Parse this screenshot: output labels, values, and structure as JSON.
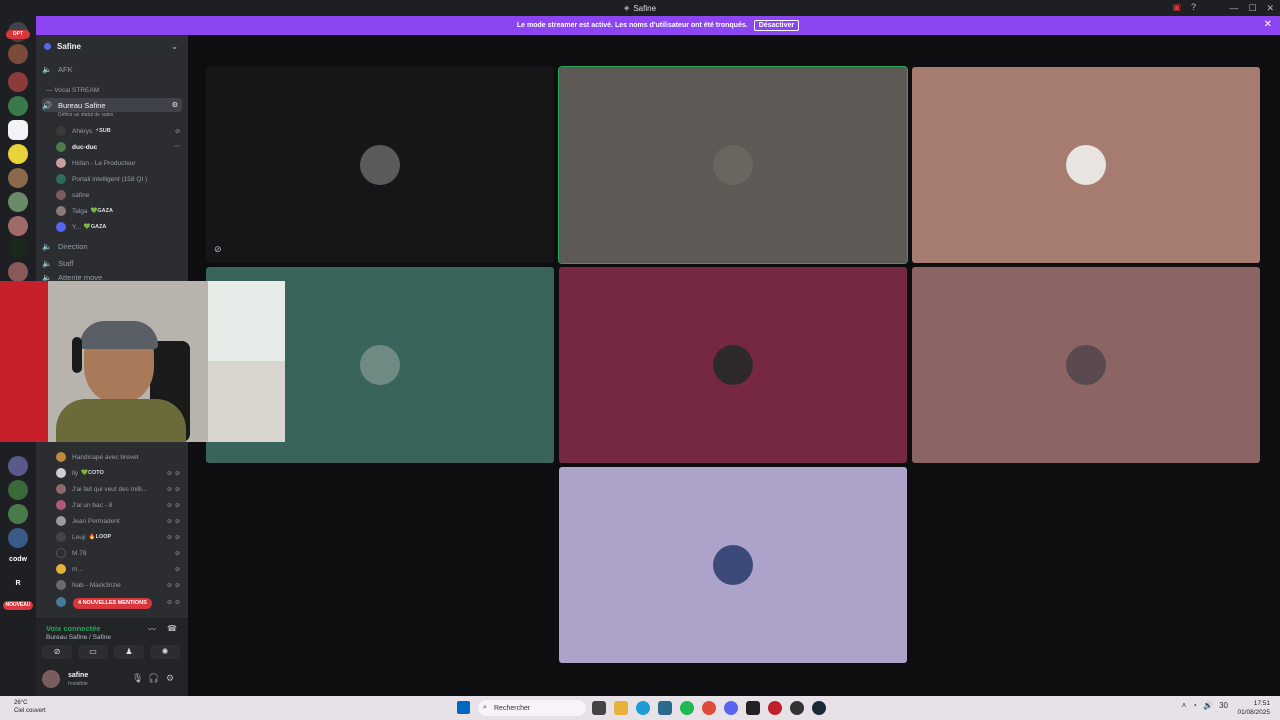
{
  "window": {
    "title": "Safine"
  },
  "banner": {
    "text": "Le mode streamer est activé. Les noms d'utilisateur ont été tronqués.",
    "button": "Désactiver"
  },
  "servers": {
    "top_badge": "DPT",
    "labels": [
      "codw",
      "R"
    ],
    "new_badge": "NOUVEAU"
  },
  "guild": {
    "name": "Safine"
  },
  "channels": {
    "afk": "AFK",
    "category": "— Vocal STREAM",
    "active": "Bureau Safine",
    "active_status": "Définir un statut de salon",
    "direction": "Direction",
    "staff": "Staff",
    "waiting": "Attente move"
  },
  "voice_users_top": [
    {
      "name": "Ahérys",
      "tag": "⚡SUB",
      "color": "#3a3a3a"
    },
    {
      "name": "duc-duc",
      "tag": "",
      "color": "#4b7a4b"
    },
    {
      "name": "Hidan - Le Producteur",
      "tag": "",
      "color": "#c9a0a0"
    },
    {
      "name": "Portail intelligent (158 QI )",
      "tag": "",
      "color": "#2f6b5a"
    },
    {
      "name": "safine",
      "tag": "",
      "color": "#7b5c5c"
    },
    {
      "name": "Talga",
      "tag": "💚GAZA",
      "color": "#8c7b7b"
    },
    {
      "name": "Y...",
      "tag": "💚GAZA",
      "color": "#5865f2"
    }
  ],
  "voice_users_bottom": [
    {
      "name": "Handicapé avec brevet",
      "tag": "",
      "color": "#c08a3e"
    },
    {
      "name": "lly",
      "tag": "💚COTO",
      "color": "#d0d0d0"
    },
    {
      "name": "J'ai fait qui veut des milli...",
      "tag": "",
      "color": "#8c6a6a"
    },
    {
      "name": "J'ai un bac - 8",
      "tag": "",
      "color": "#b05a7a"
    },
    {
      "name": "Jean Permadent",
      "tag": "",
      "color": "#9b9b9b"
    },
    {
      "name": "Leuji",
      "tag": "🔥LOOP",
      "color": "#444"
    },
    {
      "name": "M.78",
      "tag": "",
      "color": "#2b2d31"
    },
    {
      "name": "m...",
      "tag": "",
      "color": "#e8b23a"
    },
    {
      "name": "Nab - Mack3nzie",
      "tag": "",
      "color": "#6b6b6b"
    },
    {
      "name": "",
      "tag": "",
      "color": "#4a7a9a"
    }
  ],
  "mentions": "4 NOUVELLES MENTIONS",
  "voice_panel": {
    "title": "Voix connectée",
    "subtitle": "Bureau Safine / Safine"
  },
  "user_panel": {
    "name": "safine",
    "status": "Invisible"
  },
  "tiles": [
    {
      "bg": "#161618",
      "avatar": "#5a5a5a",
      "speaking": false
    },
    {
      "bg": "#5d5a55",
      "avatar": "#6b6560",
      "speaking": true
    },
    {
      "bg": "#a77c70",
      "avatar": "#e8e4e0",
      "speaking": false
    },
    {
      "bg": "#38645b",
      "avatar": "#6f8a83",
      "speaking": false
    },
    {
      "bg": "#762842",
      "avatar": "#2f2a2a",
      "speaking": false
    },
    {
      "bg": "#8a6564",
      "avatar": "#5a4a50",
      "speaking": false
    },
    {
      "bg": "#ada2c9",
      "avatar": "#3c4a7a",
      "speaking": false
    }
  ],
  "taskbar": {
    "weather_temp": "26°C",
    "weather_desc": "Ciel couvert",
    "search": "Rechercher",
    "time": "17:51",
    "date": "01/08/2025",
    "battery": "30"
  }
}
